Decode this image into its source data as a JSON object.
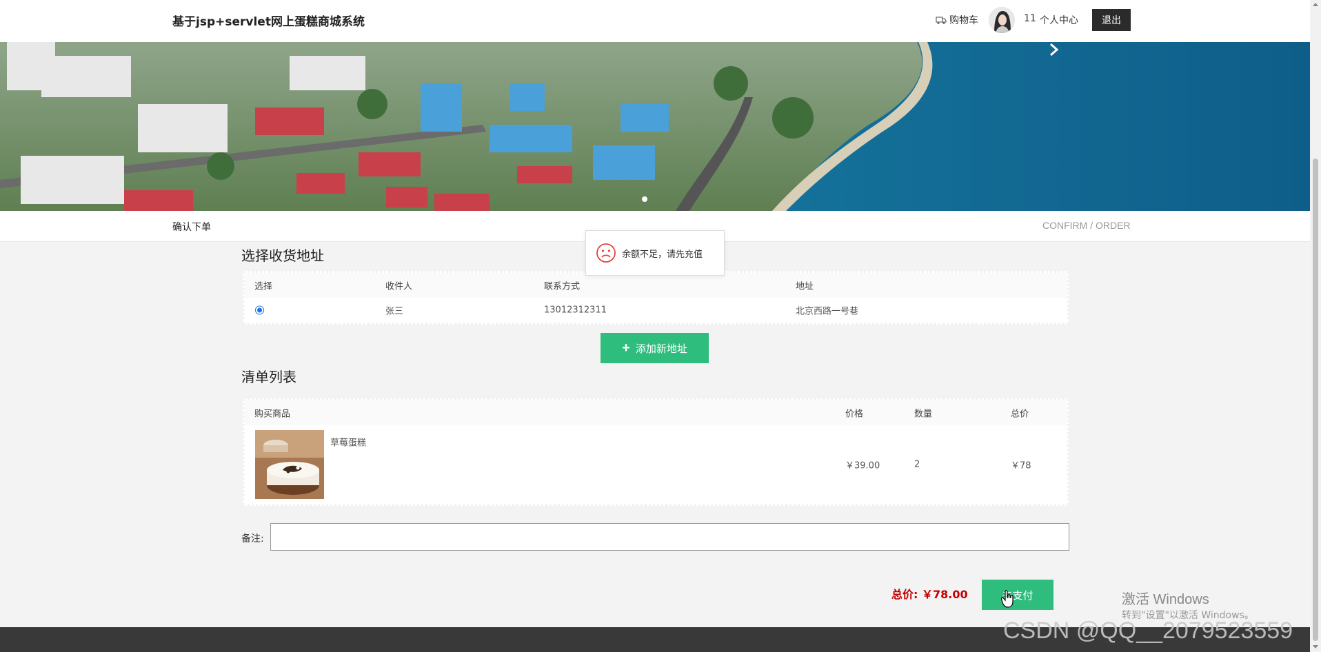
{
  "header": {
    "title": "基于jsp+servlet网上蛋糕商城系统",
    "cart_label": "购物车",
    "username": "11",
    "user_center": "个人中心",
    "logout": "退出"
  },
  "section": {
    "title": "确认下单",
    "subtitle": "CONFIRM / ORDER"
  },
  "toast": {
    "message": "余额不足，请先充值"
  },
  "address": {
    "heading": "选择收货地址",
    "columns": [
      "选择",
      "收件人",
      "联系方式",
      "地址"
    ],
    "rows": [
      {
        "receiver": "张三",
        "phone": "13012312311",
        "address": "北京西路一号巷",
        "selected": true
      }
    ],
    "add_button": "添加新地址"
  },
  "order": {
    "heading": "清单列表",
    "columns": [
      "购买商品",
      "价格",
      "数量",
      "总价"
    ],
    "items": [
      {
        "name": "草莓蛋糕",
        "price": "￥39.00",
        "quantity": "2",
        "subtotal": "￥78"
      }
    ]
  },
  "note": {
    "label": "备注:",
    "value": ""
  },
  "checkout": {
    "total_label": "总价:",
    "total_value": "￥78.00",
    "pay_button": "去支付"
  },
  "overlay": {
    "activate_title": "激活 Windows",
    "activate_sub": "转到\"设置\"以激活 Windows。",
    "csdn": "CSDN @QQ__2079523559"
  },
  "colors": {
    "accent_green": "#2ebd7d",
    "price_red": "#c40000",
    "footer": "#393939"
  }
}
